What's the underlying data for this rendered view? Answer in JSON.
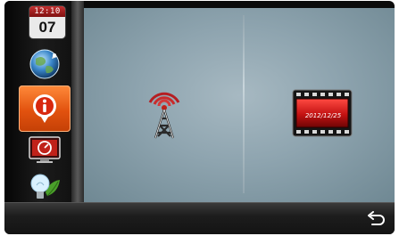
{
  "clock": {
    "time": "12:10",
    "day": "07"
  },
  "sidebar": {
    "items": [
      {
        "name": "globe-icon"
      },
      {
        "name": "info-icon",
        "active": true
      },
      {
        "name": "speedometer-tv-icon"
      },
      {
        "name": "lightbulb-leaf-icon"
      }
    ]
  },
  "main": {
    "left_tile": {
      "icon": "signal-tower-icon"
    },
    "right_tile": {
      "icon": "film-strip-icon",
      "date": "2012/12/25"
    }
  },
  "bottombar": {
    "back_icon": "back-arrow-icon"
  },
  "colors": {
    "active": "#e2520f",
    "accent_red": "#c0221a",
    "panel": "#8ea4af"
  }
}
